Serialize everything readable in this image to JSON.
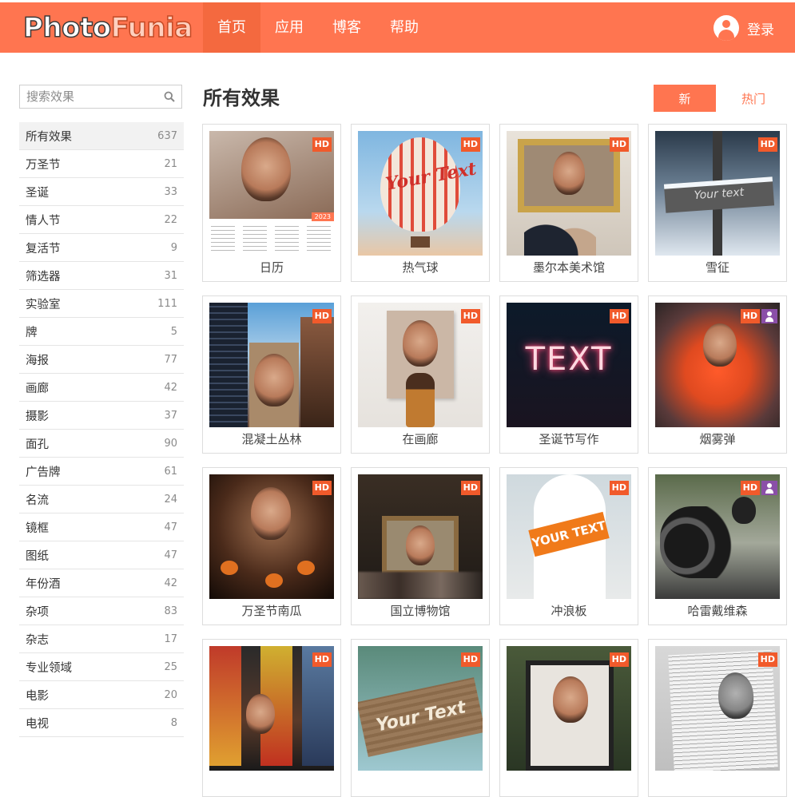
{
  "header": {
    "logo_photo": "Photo",
    "logo_funia": "Funia",
    "nav": [
      {
        "label": "首页",
        "active": true
      },
      {
        "label": "应用",
        "active": false
      },
      {
        "label": "博客",
        "active": false
      },
      {
        "label": "帮助",
        "active": false
      }
    ],
    "login_label": "登录"
  },
  "sidebar": {
    "search_placeholder": "搜索效果",
    "categories": [
      {
        "label": "所有效果",
        "count": "637"
      },
      {
        "label": "万圣节",
        "count": "21"
      },
      {
        "label": "圣诞",
        "count": "33"
      },
      {
        "label": "情人节",
        "count": "22"
      },
      {
        "label": "复活节",
        "count": "9"
      },
      {
        "label": "筛选器",
        "count": "31"
      },
      {
        "label": "实验室",
        "count": "111"
      },
      {
        "label": "牌",
        "count": "5"
      },
      {
        "label": "海报",
        "count": "77"
      },
      {
        "label": "画廊",
        "count": "42"
      },
      {
        "label": "摄影",
        "count": "37"
      },
      {
        "label": "面孔",
        "count": "90"
      },
      {
        "label": "广告牌",
        "count": "61"
      },
      {
        "label": "名流",
        "count": "24"
      },
      {
        "label": "镜框",
        "count": "47"
      },
      {
        "label": "图纸",
        "count": "47"
      },
      {
        "label": "年份酒",
        "count": "42"
      },
      {
        "label": "杂项",
        "count": "83"
      },
      {
        "label": "杂志",
        "count": "17"
      },
      {
        "label": "专业领域",
        "count": "25"
      },
      {
        "label": "电影",
        "count": "20"
      },
      {
        "label": "电视",
        "count": "8"
      }
    ]
  },
  "main": {
    "title": "所有效果",
    "btn_new": "新",
    "btn_hot": "热门",
    "hd_label": "HD",
    "effects": [
      {
        "label": "日历",
        "thumb": "calendar",
        "image_text": "2023"
      },
      {
        "label": "热气球",
        "thumb": "balloon",
        "image_text": "Your Text"
      },
      {
        "label": "墨尔本美术馆",
        "thumb": "gallery"
      },
      {
        "label": "雪征",
        "thumb": "snow",
        "image_text": "Your text"
      },
      {
        "label": "混凝土丛林",
        "thumb": "city"
      },
      {
        "label": "在画廊",
        "thumb": "wall"
      },
      {
        "label": "圣诞节写作",
        "thumb": "neon",
        "image_text": "TEXT"
      },
      {
        "label": "烟雾弹",
        "thumb": "smoke",
        "user_badge": true
      },
      {
        "label": "万圣节南瓜",
        "thumb": "pumpkin"
      },
      {
        "label": "国立博物馆",
        "thumb": "museum"
      },
      {
        "label": "冲浪板",
        "thumb": "surf",
        "image_text": "YOUR TEXT"
      },
      {
        "label": "哈雷戴维森",
        "thumb": "moto",
        "user_badge": true
      },
      {
        "label": "",
        "thumb": "times"
      },
      {
        "label": "",
        "thumb": "wood",
        "image_text": "Your Text"
      },
      {
        "label": "",
        "thumb": "hold"
      },
      {
        "label": "",
        "thumb": "paper"
      }
    ]
  },
  "colors": {
    "accent": "#ff7550",
    "hd_badge": "#f15a2b",
    "user_badge": "#8a4fa8"
  },
  "icons": {
    "search": "search-icon",
    "user": "user-icon"
  }
}
